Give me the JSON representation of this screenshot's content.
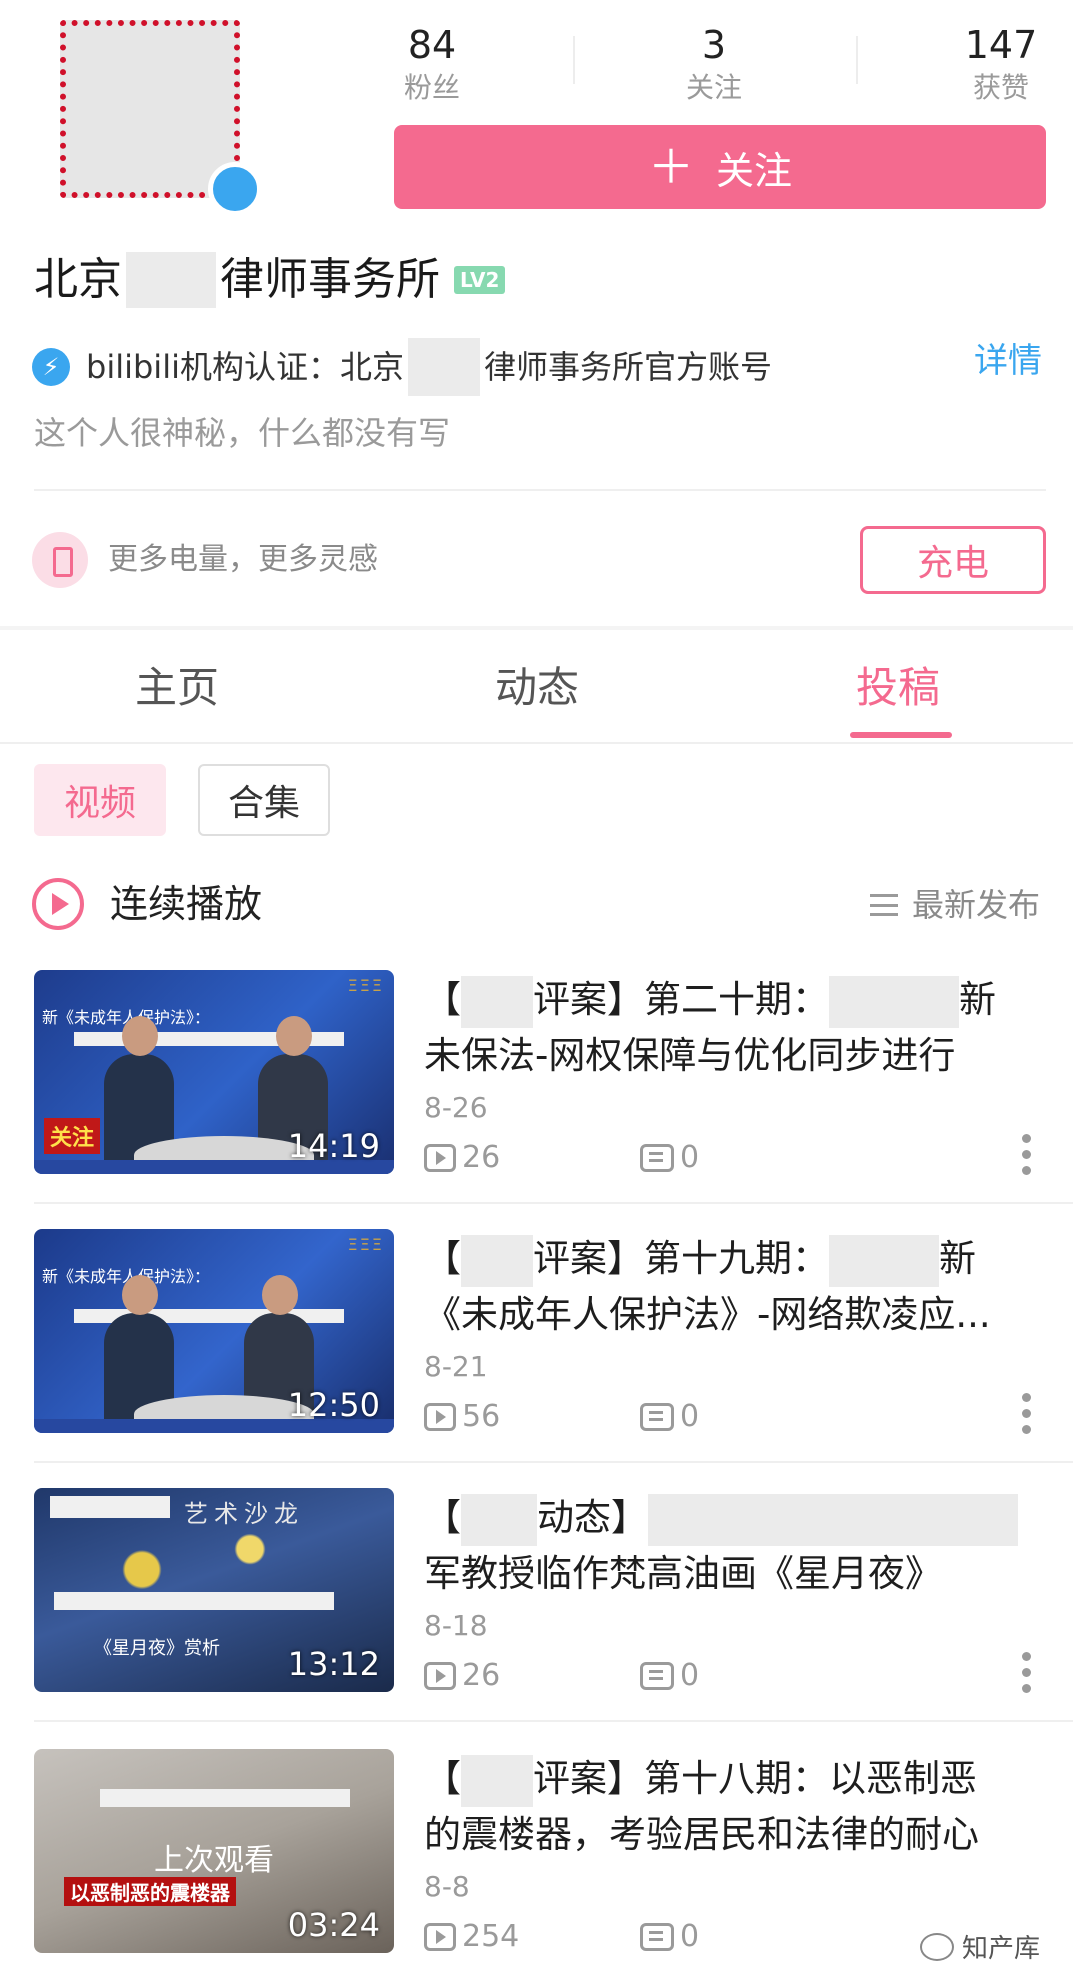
{
  "profile": {
    "stats": [
      {
        "value": "84",
        "label": "粉丝"
      },
      {
        "value": "3",
        "label": "关注"
      },
      {
        "value": "147",
        "label": "获赞"
      }
    ],
    "follow_plus": "＋",
    "follow_label": "关注",
    "name_prefix": "北京",
    "name_suffix": "律师事务所",
    "level": "LV2",
    "verify_prefix": "bilibili机构认证：北京",
    "verify_suffix": "律师事务所官方账号",
    "detail_link": "详情",
    "bio": "这个人很神秘，什么都没有写",
    "battery_text": "更多电量，更多灵感",
    "charge_button": "充电"
  },
  "tabs": [
    {
      "label": "主页",
      "active": false
    },
    {
      "label": "动态",
      "active": false
    },
    {
      "label": "投稿",
      "active": true
    }
  ],
  "filters": [
    {
      "label": "视频",
      "active": true
    },
    {
      "label": "合集",
      "active": false
    }
  ],
  "list_header": {
    "play_all": "连续播放",
    "sort": "最新发布"
  },
  "videos": [
    {
      "title_a": "【",
      "title_b": "评案】第二十期：",
      "title_c": "新",
      "title_line2": "未保法-网权保障与优化同步进行",
      "date": "8-26",
      "views": "26",
      "comments": "0",
      "duration": "14:19",
      "thumb_caption": "新《未成年人保护法》：",
      "thumb_tag": "关注"
    },
    {
      "title_a": "【",
      "title_b": "评案】第十九期：",
      "title_c": "新",
      "title_line2": "《未成年人保护法》-网络欺凌应...",
      "date": "8-21",
      "views": "56",
      "comments": "0",
      "duration": "12:50",
      "thumb_caption": "新《未成年人保护法》："
    },
    {
      "title_a": "【",
      "title_b": "动态】",
      "title_c": "",
      "title_line2": "军教授临作梵高油画《星月夜》",
      "date": "8-18",
      "views": "26",
      "comments": "0",
      "duration": "13:12",
      "thumb_caption": "艺术沙龙",
      "thumb_sub": "《星月夜》赏析"
    },
    {
      "title_a": "【",
      "title_b": "评案】第十八期：以恶制恶",
      "title_line2": "的震楼器，考验居民和法律的耐心",
      "date": "8-8",
      "views": "254",
      "comments": "0",
      "duration": "03:24",
      "thumb_last_watched": "上次观看",
      "thumb_red1": "以恶制恶的震楼器"
    }
  ],
  "watermark": "知产库",
  "colors": {
    "accent": "#f46a8f",
    "link": "#3aa6ef",
    "muted": "#9a9a9a"
  }
}
